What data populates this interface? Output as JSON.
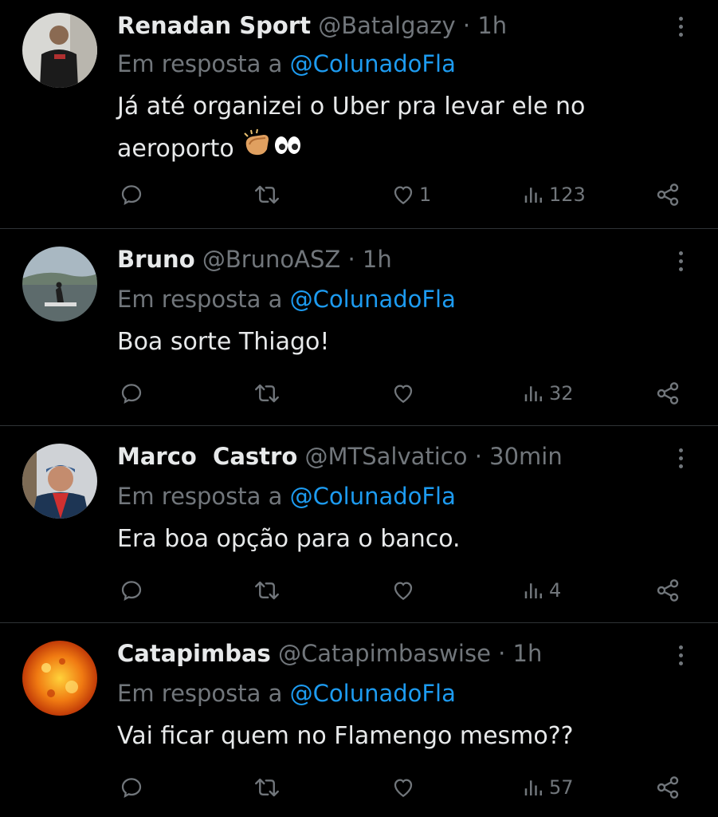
{
  "reply_prefix": "Em resposta a",
  "colors": {
    "background": "#000000",
    "text": "#e7e9ea",
    "muted": "#71767b",
    "accent": "#1d9bf0",
    "divider": "#2f3336"
  },
  "icons": [
    "more-icon",
    "reply-icon",
    "retweet-icon",
    "like-icon",
    "views-icon",
    "share-icon",
    "clapping-hands-emoji",
    "eyes-emoji"
  ],
  "tweets": [
    {
      "name": "Renadan Sport",
      "handle": "@Batalgazy",
      "time": "· 1h",
      "reply_to": "@ColunadoFla",
      "text_line1": "Já até organizei o Uber pra levar ele no",
      "text_line2": "aeroporto",
      "likes": "1",
      "views": "123"
    },
    {
      "name": "Bruno",
      "handle": "@BrunoASZ",
      "time": "· 1h",
      "reply_to": "@ColunadoFla",
      "text": "Boa sorte Thiago!",
      "likes": "",
      "views": "32"
    },
    {
      "name": "Marco  Castro",
      "handle": "@MTSalvatico",
      "time": "· 30min",
      "reply_to": "@ColunadoFla",
      "text": "Era boa opção para o banco.",
      "likes": "",
      "views": "4"
    },
    {
      "name": "Catapimbas",
      "handle": "@Catapimbaswise",
      "time": "· 1h",
      "reply_to": "@ColunadoFla",
      "text": "Vai ficar quem no Flamengo mesmo??",
      "likes": "",
      "views": "57"
    }
  ]
}
